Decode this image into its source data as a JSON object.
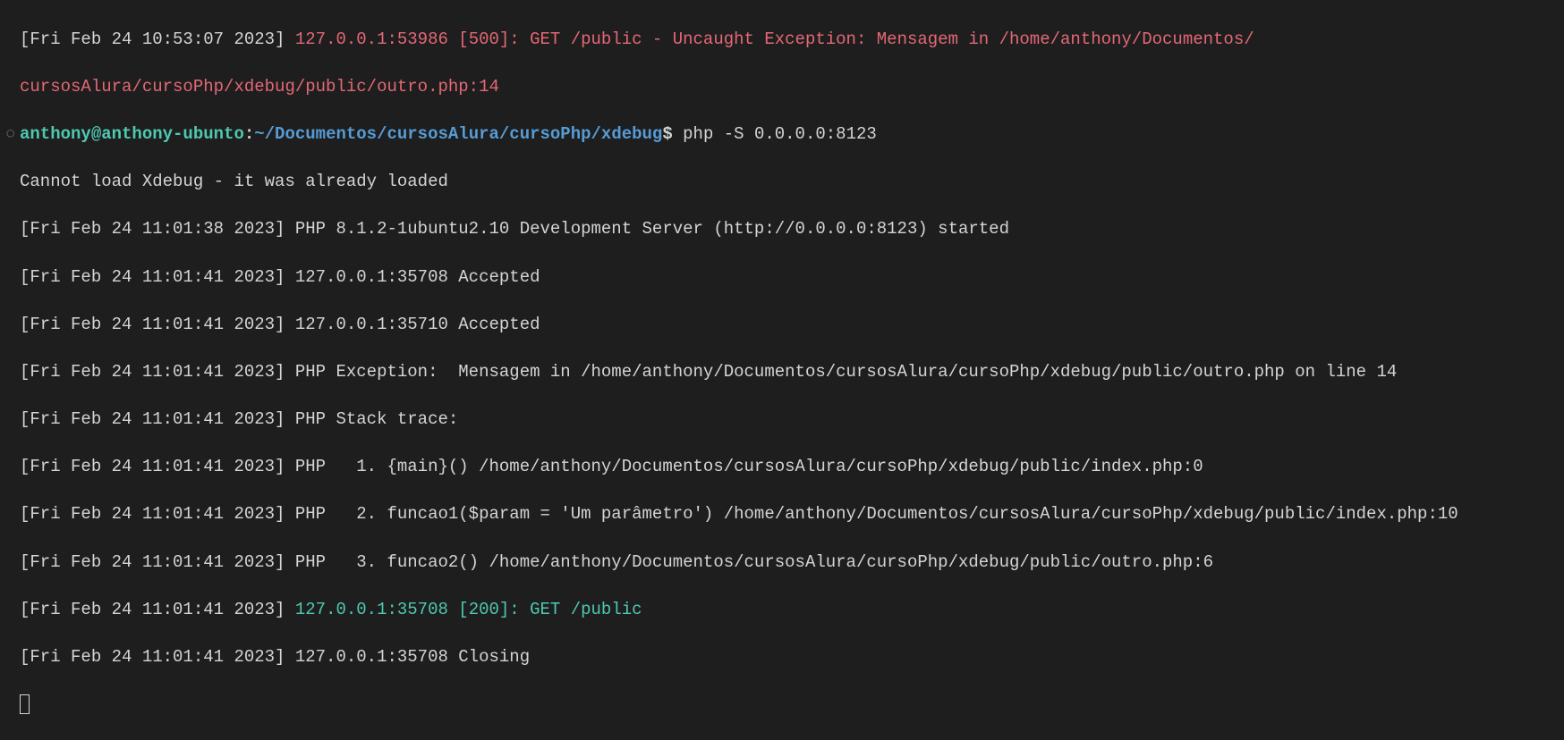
{
  "error_line_1": {
    "prefix": "[Fri Feb 24 10:53:07 2023] ",
    "red_part_a": "127.0.0.1:53986 [500]: GET /public - Uncaught Exception: Mensagem in /home/anthony/Documentos/",
    "red_part_b": "cursosAlura/cursoPhp/xdebug/public/outro.php:14"
  },
  "prompt": {
    "bullet": "○ ",
    "user": "anthony@anthony-ubunto",
    "colon": ":",
    "path": "~/Documentos/cursosAlura/cursoPhp/xdebug",
    "dollar": "$ ",
    "command": "php -S 0.0.0.0:8123"
  },
  "out": {
    "l1": "Cannot load Xdebug - it was already loaded",
    "l2": "[Fri Feb 24 11:01:38 2023] PHP 8.1.2-1ubuntu2.10 Development Server (http://0.0.0.0:8123) started",
    "l3": "[Fri Feb 24 11:01:41 2023] 127.0.0.1:35708 Accepted",
    "l4": "[Fri Feb 24 11:01:41 2023] 127.0.0.1:35710 Accepted",
    "l5": "[Fri Feb 24 11:01:41 2023] PHP Exception:  Mensagem in /home/anthony/Documentos/cursosAlura/cursoPhp/xdebug/public/outro.php on line 14",
    "l6": "[Fri Feb 24 11:01:41 2023] PHP Stack trace:",
    "l7": "[Fri Feb 24 11:01:41 2023] PHP   1. {main}() /home/anthony/Documentos/cursosAlura/cursoPhp/xdebug/public/index.php:0",
    "l8": "[Fri Feb 24 11:01:41 2023] PHP   2. funcao1($param = 'Um parâmetro') /home/anthony/Documentos/cursosAlura/cursoPhp/xdebug/public/index.php:10",
    "l9": "[Fri Feb 24 11:01:41 2023] PHP   3. funcao2() /home/anthony/Documentos/cursosAlura/cursoPhp/xdebug/public/outro.php:6",
    "l10_prefix": "[Fri Feb 24 11:01:41 2023] ",
    "l10_green": "127.0.0.1:35708 [200]: GET /public",
    "l11": "[Fri Feb 24 11:01:41 2023] 127.0.0.1:35708 Closing"
  }
}
